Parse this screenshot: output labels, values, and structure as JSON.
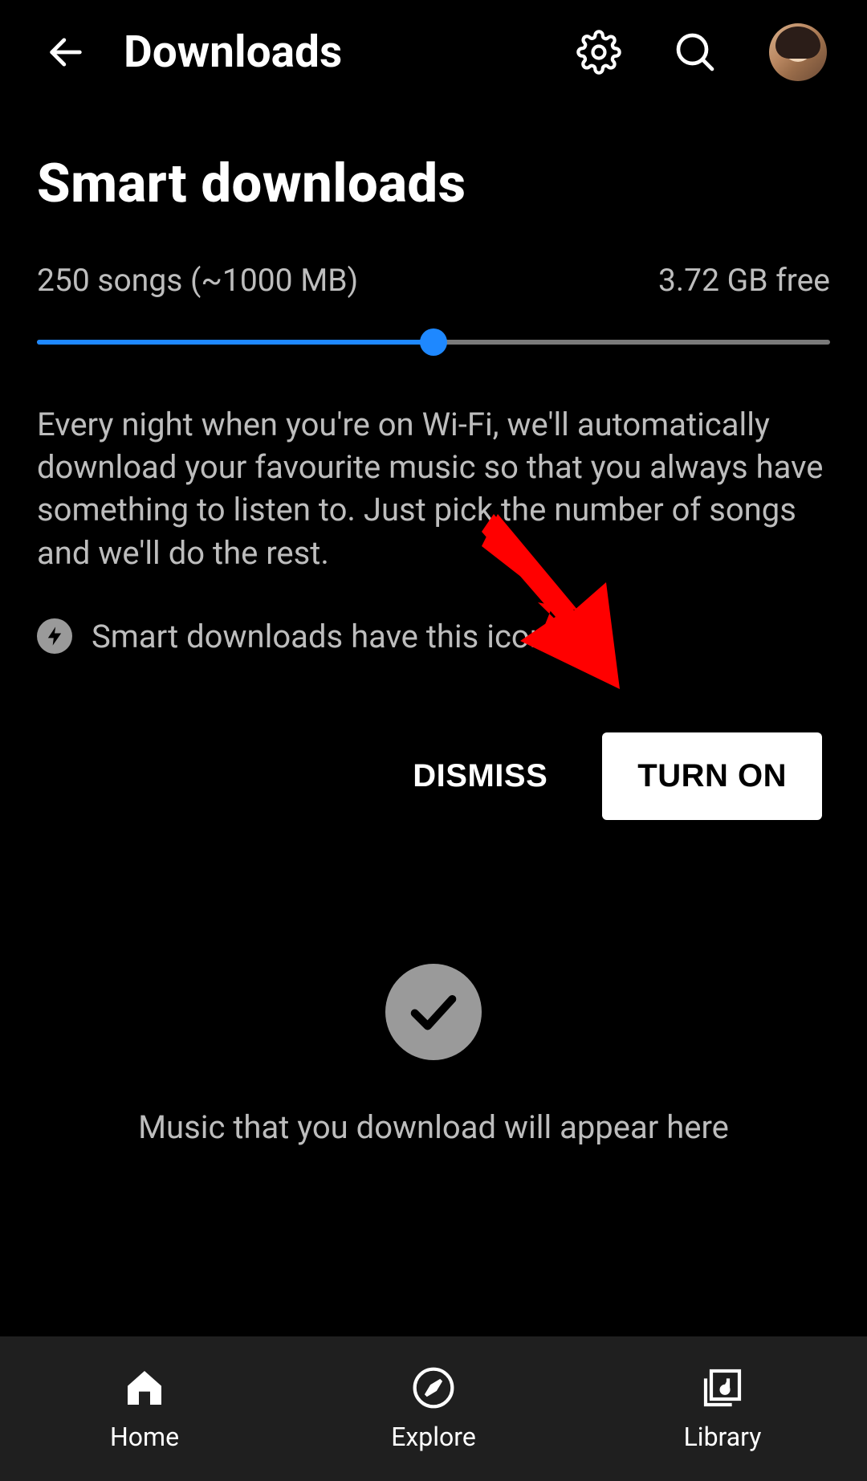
{
  "header": {
    "title": "Downloads"
  },
  "smart_downloads": {
    "title": "Smart downloads",
    "stats_left": "250 songs (~1000 MB)",
    "stats_right": "3.72 GB free",
    "slider_percent": 50,
    "description": "Every night when you're on Wi-Fi, we'll automatically download your favourite music so that you always have something to listen to. Just pick the number of songs and we'll do the rest.",
    "icon_note": "Smart downloads have this icon",
    "dismiss_label": "DISMISS",
    "turn_on_label": "TURN ON"
  },
  "empty_state": {
    "message": "Music that you download will appear here"
  },
  "bottom_nav": {
    "items": [
      {
        "label": "Home"
      },
      {
        "label": "Explore"
      },
      {
        "label": "Library"
      }
    ]
  }
}
